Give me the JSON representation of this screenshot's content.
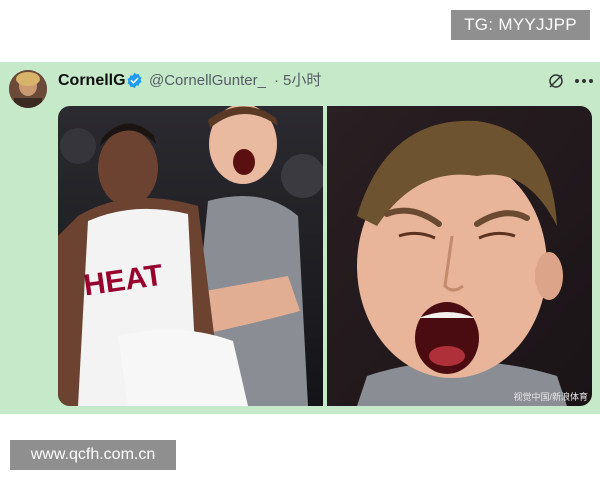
{
  "watermark_top": "TG: MYYJJPP",
  "watermark_bottom": "www.qcfh.com.cn",
  "post": {
    "author_name": "CornellG",
    "handle": "@CornellGunter_",
    "separator": "·",
    "time": "5小时",
    "jersey_text": "HEAT",
    "photo_credit": "视觉中国/新浪体育"
  },
  "icons": {
    "verified": "verified-badge-icon",
    "grok": "grok-icon",
    "more": "more-options-icon"
  },
  "colors": {
    "card_background": "#c6e9c9",
    "verified_blue": "#1d9bf0",
    "watermark_gray": "#8f8f8f",
    "heat_red": "#98002e"
  }
}
